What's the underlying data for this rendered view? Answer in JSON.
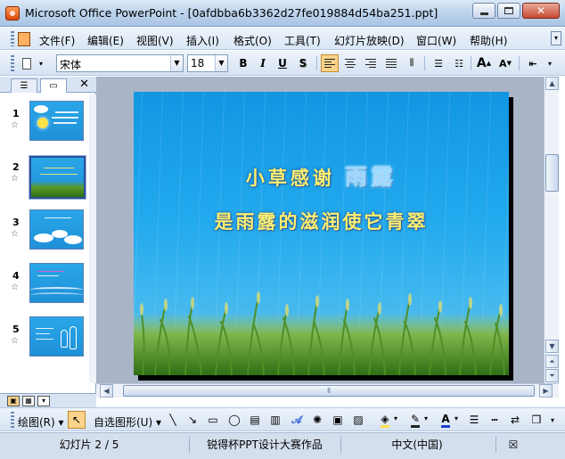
{
  "window": {
    "title": "Microsoft Office PowerPoint - [0afdbba6b3362d27fe019884d54ba251.ppt]"
  },
  "menu": {
    "items": [
      {
        "label": "文件(F)"
      },
      {
        "label": "编辑(E)"
      },
      {
        "label": "视图(V)"
      },
      {
        "label": "插入(I)"
      },
      {
        "label": "格式(O)"
      },
      {
        "label": "工具(T)"
      },
      {
        "label": "幻灯片放映(D)"
      },
      {
        "label": "窗口(W)"
      },
      {
        "label": "帮助(H)"
      }
    ]
  },
  "toolbar": {
    "font_name": "宋体",
    "font_size": "18",
    "bold": "B",
    "italic": "I",
    "underline": "U",
    "shadow": "S",
    "grow_font": "A",
    "shrink_font": "A",
    "active_alignment": "align-left"
  },
  "slides_pane": {
    "selected_index": 2,
    "slides": [
      {
        "number": "1",
        "theme": "sun-sky"
      },
      {
        "number": "2",
        "theme": "grass"
      },
      {
        "number": "3",
        "theme": "clouds"
      },
      {
        "number": "4",
        "theme": "waves"
      },
      {
        "number": "5",
        "theme": "figures"
      }
    ]
  },
  "slide": {
    "line1_prefix": "小草感谢",
    "line1_highlight": "雨露",
    "line2": "是雨露的滋润使它青翠",
    "colors": {
      "sky_top": "#1296e2",
      "text": "#ffef70",
      "highlight": "#9ad8ff"
    }
  },
  "drawing_toolbar": {
    "draw_label": "绘图(R)",
    "autoshapes_label": "自选图形(U)"
  },
  "status": {
    "slide_info": "幻灯片 2 / 5",
    "design": "锐得杯PPT设计大赛作品",
    "language": "中文(中国)"
  }
}
